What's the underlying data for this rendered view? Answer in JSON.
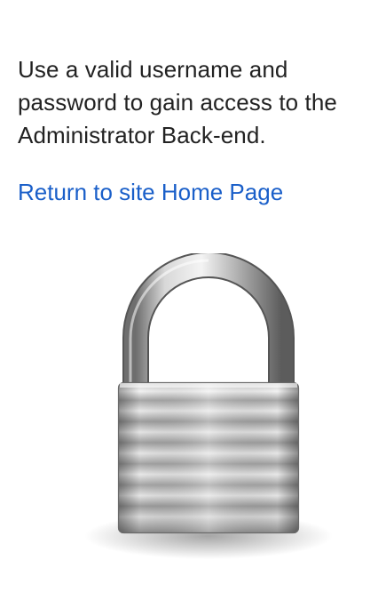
{
  "login_info": {
    "instructions": "Use a valid username and password to gain access to the Administrator Back-end.",
    "home_link_label": "Return to site Home Page"
  },
  "icons": {
    "lock": "padlock-icon"
  },
  "colors": {
    "text": "#222222",
    "link": "#1a5fc9",
    "background": "#ffffff"
  }
}
